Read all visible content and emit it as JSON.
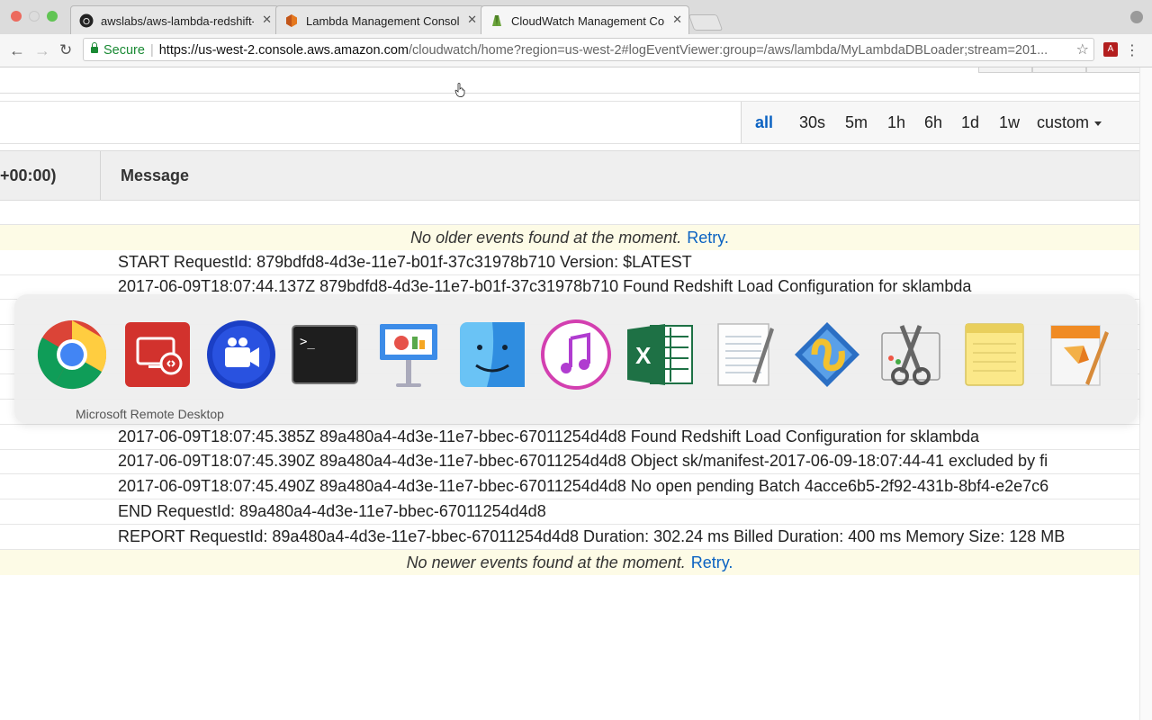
{
  "browser": {
    "tabs": [
      {
        "label": "awslabs/aws-lambda-redshift-",
        "active": false,
        "icon": "github-icon"
      },
      {
        "label": "Lambda Management Console",
        "active": false,
        "icon": "aws-icon"
      },
      {
        "label": "CloudWatch Management Con",
        "active": true,
        "icon": "cloudwatch-icon"
      }
    ],
    "secure_label": "Secure",
    "url_host": "https://us-west-2.console.aws.amazon.com",
    "url_rest": "/cloudwatch/home?region=us-west-2#logEventViewer:group=/aws/lambda/MyLambdaDBLoader;stream=201..."
  },
  "filter": {
    "ranges": [
      "all",
      "30s",
      "5m",
      "1h",
      "6h",
      "1d",
      "1w",
      "custom"
    ],
    "active_range": "all"
  },
  "table": {
    "time_header": "+00:00)",
    "message_header": "Message"
  },
  "notices": {
    "older_text": "No older events found at the moment.",
    "newer_text": "No newer events found at the moment.",
    "retry_label": "Retry."
  },
  "log_rows_top": [
    "START RequestId: 879bdfd8-4d3e-11e7-b01f-37c31978b710 Version: $LATEST",
    "2017-06-09T18:07:44.137Z 879bdfd8-4d3e-11e7-b01f-37c31978b710 Found Redshift Load Configuration for sklambda"
  ],
  "log_rows_bottom": [
    "2017-06-09T18:07:45.385Z 89a480a4-4d3e-11e7-bbec-67011254d4d8 Found Redshift Load Configuration for sklambda",
    "2017-06-09T18:07:45.390Z 89a480a4-4d3e-11e7-bbec-67011254d4d8 Object sk/manifest-2017-06-09-18:07:44-41 excluded by fi",
    "2017-06-09T18:07:45.490Z 89a480a4-4d3e-11e7-bbec-67011254d4d8 No open pending Batch 4acce6b5-2f92-431b-8bf4-e2e7c6",
    "END RequestId: 89a480a4-4d3e-11e7-bbec-67011254d4d8",
    "REPORT RequestId: 89a480a4-4d3e-11e7-bbec-67011254d4d8 Duration: 302.24 ms Billed Duration: 400 ms Memory Size: 128 MB"
  ],
  "app_switcher": {
    "selected_label": "Microsoft Remote Desktop",
    "apps": [
      "chrome-icon",
      "microsoft-remote-desktop-icon",
      "video-app-icon",
      "terminal-icon",
      "keynote-icon",
      "finder-icon",
      "itunes-icon",
      "excel-icon",
      "textedit-icon",
      "mail-stamp-icon",
      "screenshot-scissors-icon",
      "notes-icon",
      "pages-icon"
    ]
  }
}
